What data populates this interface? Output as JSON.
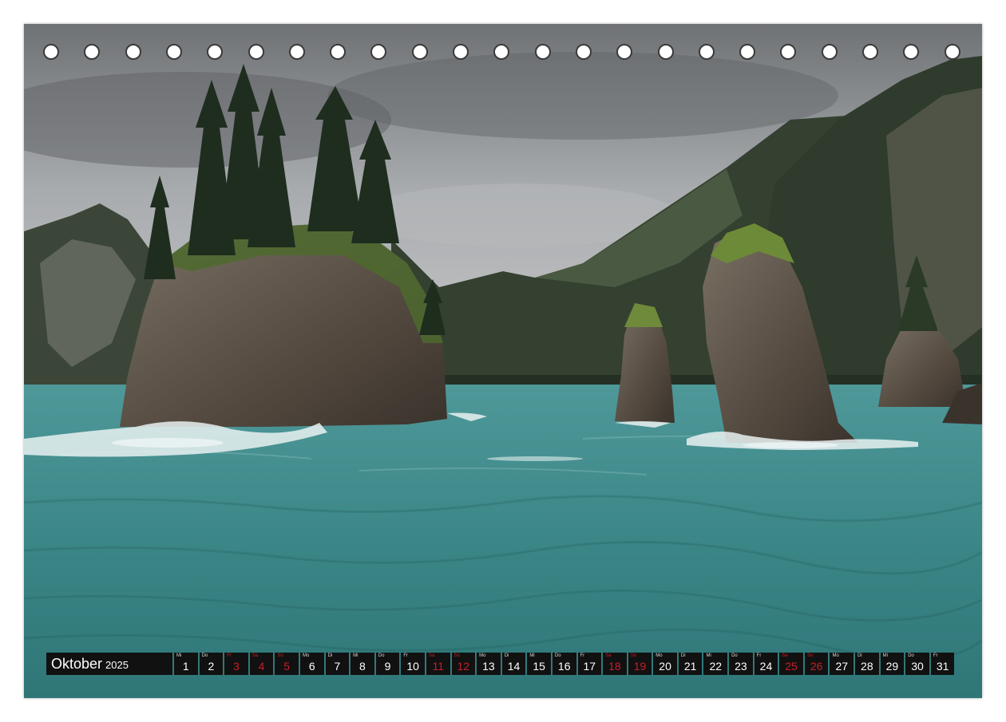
{
  "calendar": {
    "month": "Oktober",
    "year": "2025",
    "days": [
      {
        "n": "1",
        "wd": "Mi",
        "we": false
      },
      {
        "n": "2",
        "wd": "Do",
        "we": false
      },
      {
        "n": "3",
        "wd": "Fr",
        "we": true
      },
      {
        "n": "4",
        "wd": "Sa",
        "we": true
      },
      {
        "n": "5",
        "wd": "So",
        "we": true
      },
      {
        "n": "6",
        "wd": "Mo",
        "we": false
      },
      {
        "n": "7",
        "wd": "Di",
        "we": false
      },
      {
        "n": "8",
        "wd": "Mi",
        "we": false
      },
      {
        "n": "9",
        "wd": "Do",
        "we": false
      },
      {
        "n": "10",
        "wd": "Fr",
        "we": false
      },
      {
        "n": "11",
        "wd": "Sa",
        "we": true
      },
      {
        "n": "12",
        "wd": "So",
        "we": true
      },
      {
        "n": "13",
        "wd": "Mo",
        "we": false
      },
      {
        "n": "14",
        "wd": "Di",
        "we": false
      },
      {
        "n": "15",
        "wd": "Mi",
        "we": false
      },
      {
        "n": "16",
        "wd": "Do",
        "we": false
      },
      {
        "n": "17",
        "wd": "Fr",
        "we": false
      },
      {
        "n": "18",
        "wd": "Sa",
        "we": true
      },
      {
        "n": "19",
        "wd": "So",
        "we": true
      },
      {
        "n": "20",
        "wd": "Mo",
        "we": false
      },
      {
        "n": "21",
        "wd": "Di",
        "we": false
      },
      {
        "n": "22",
        "wd": "Mi",
        "we": false
      },
      {
        "n": "23",
        "wd": "Do",
        "we": false
      },
      {
        "n": "24",
        "wd": "Fr",
        "we": false
      },
      {
        "n": "25",
        "wd": "Sa",
        "we": true
      },
      {
        "n": "26",
        "wd": "So",
        "we": true
      },
      {
        "n": "27",
        "wd": "Mo",
        "we": false
      },
      {
        "n": "28",
        "wd": "Di",
        "we": false
      },
      {
        "n": "29",
        "wd": "Mi",
        "we": false
      },
      {
        "n": "30",
        "wd": "Do",
        "we": false
      },
      {
        "n": "31",
        "wd": "Fr",
        "we": false
      }
    ]
  },
  "colors": {
    "sky": "#a9acaf",
    "water": "#3f8a8c",
    "rock": "#5e554b",
    "forest": "#2e3d2e",
    "bar": "#111111",
    "weekend": "#c4202a"
  }
}
